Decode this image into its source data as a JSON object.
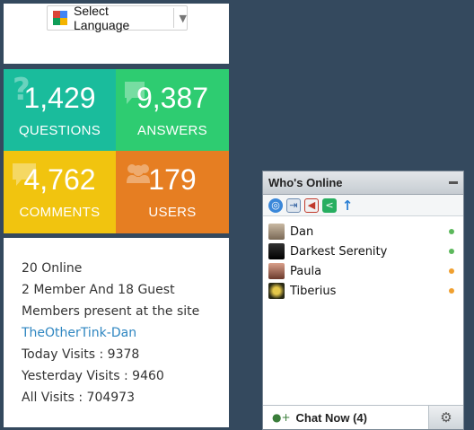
{
  "language": {
    "label": "Select Language"
  },
  "stats": [
    {
      "value": "1,429",
      "label": "QUESTIONS",
      "icon": "question-icon",
      "color": "#1abc9c"
    },
    {
      "value": "9,387",
      "label": "ANSWERS",
      "icon": "speech-bubble-icon",
      "color": "#2ecc71"
    },
    {
      "value": "4,762",
      "label": "COMMENTS",
      "icon": "comment-icon",
      "color": "#f1c40f"
    },
    {
      "value": "179",
      "label": "USERS",
      "icon": "users-icon",
      "color": "#e67e22"
    }
  ],
  "online": {
    "count": "20 Online",
    "breakdown": "2 Member And 18 Guest",
    "present": "Members present at the site",
    "member_link": "TheOtherTink-Dan",
    "today": "Today Visits : 9378",
    "yesterday": "Yesterday Visits : 9460",
    "all": "All Visits : 704973"
  },
  "chat": {
    "title": "Who's Online",
    "users": [
      {
        "name": "Dan",
        "status": "online"
      },
      {
        "name": "Darkest Serenity",
        "status": "online"
      },
      {
        "name": "Paula",
        "status": "away"
      },
      {
        "name": "Tiberius",
        "status": "away"
      }
    ],
    "chat_now": "Chat Now (4)"
  }
}
